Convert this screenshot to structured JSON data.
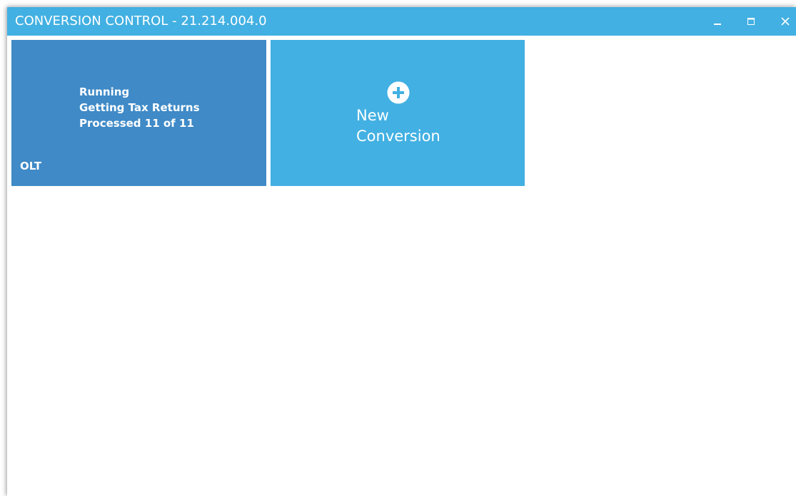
{
  "window": {
    "title": "CONVERSION CONTROL - 21.214.004.0",
    "controls": {
      "minimize_icon": "minimize-icon",
      "maximize_icon": "maximize-icon",
      "close_icon": "close-icon"
    }
  },
  "tiles": {
    "job": {
      "status": "Running",
      "step": "Getting Tax Returns",
      "progress": "Processed 11 of 11",
      "code": "OLT",
      "color": "#3f8ac7"
    },
    "new_conversion": {
      "icon": "plus-circle-icon",
      "label_line1": "New",
      "label_line2": "Conversion",
      "color": "#42b0e2"
    }
  },
  "colors": {
    "titlebar": "#42b0e2",
    "background": "#ffffff",
    "text": "#ffffff"
  }
}
